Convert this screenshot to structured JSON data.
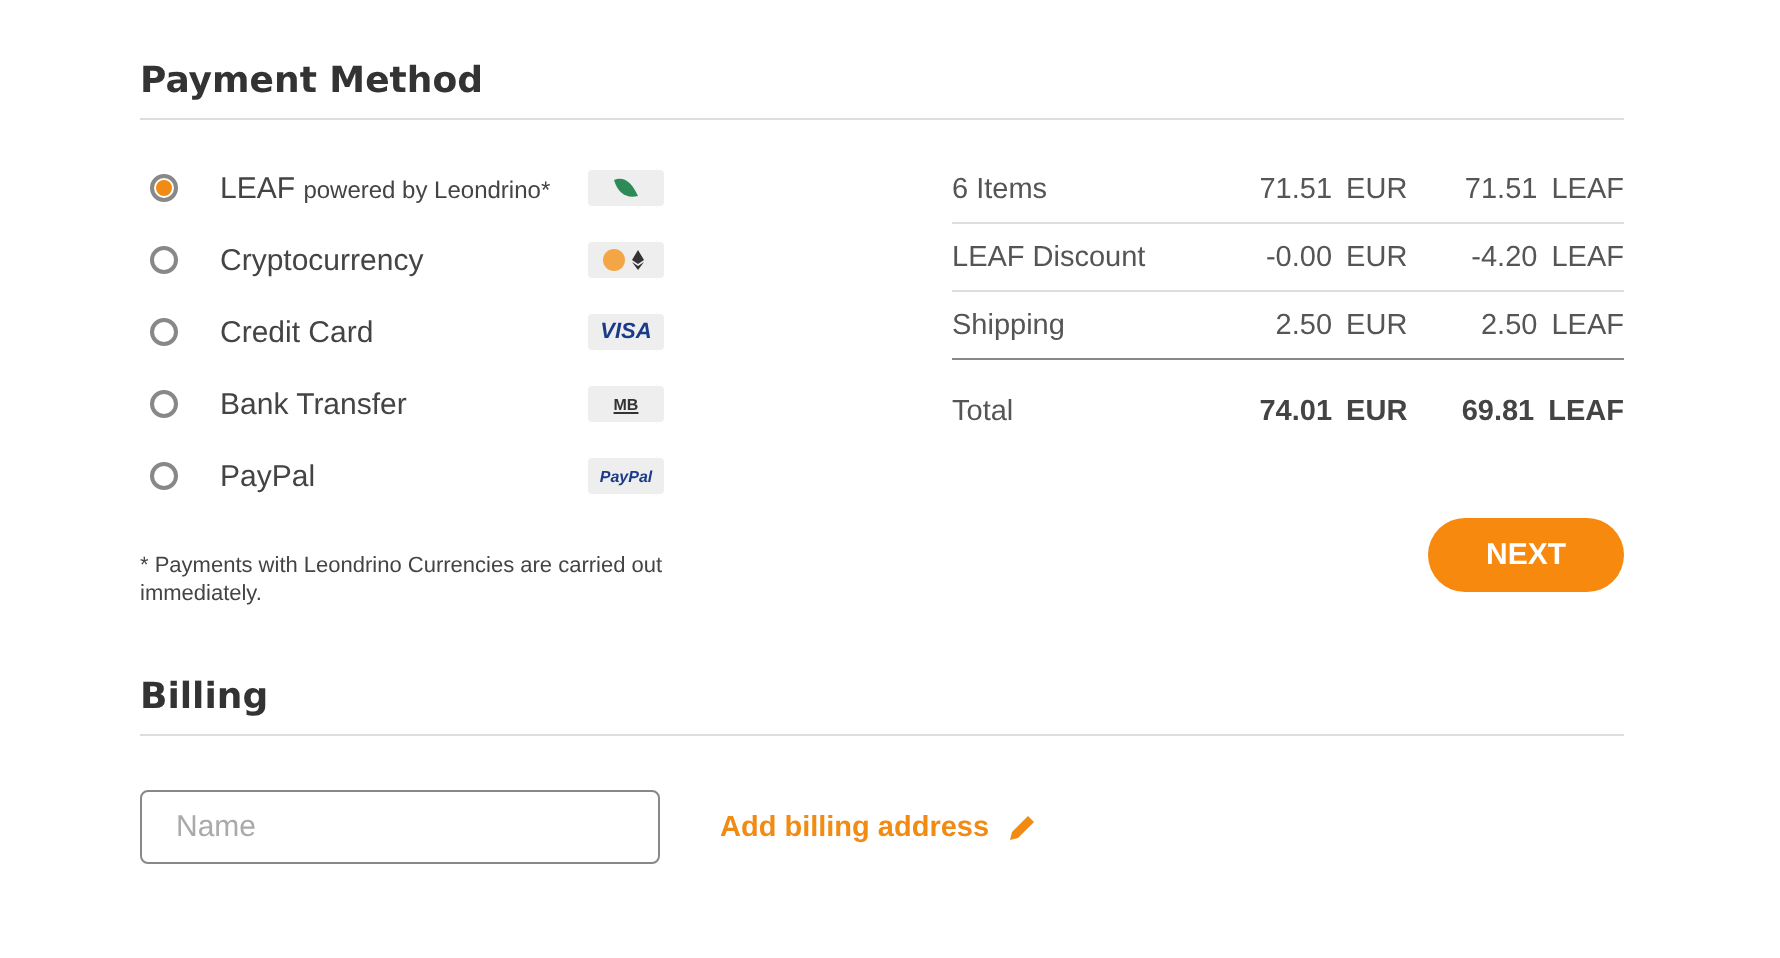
{
  "payment": {
    "title": "Payment Method",
    "methods": [
      {
        "label": "LEAF",
        "sublabel": "powered by Leondrino*",
        "selected": true,
        "kind": "leaf"
      },
      {
        "label": "Cryptocurrency",
        "selected": false,
        "kind": "crypto"
      },
      {
        "label": "Credit Card",
        "selected": false,
        "kind": "card",
        "logo_text": "VISA"
      },
      {
        "label": "Bank Transfer",
        "selected": false,
        "kind": "bank",
        "logo_text": "MB"
      },
      {
        "label": "PayPal",
        "selected": false,
        "kind": "paypal",
        "logo_text": "PayPal"
      }
    ],
    "note": "* Payments with Leondrino Currencies are carried out immediately.",
    "summary": [
      {
        "label": "6 Items",
        "eur": "71.51 EUR",
        "leaf": "71.51 LEAF",
        "kind": "line"
      },
      {
        "label": "LEAF Discount",
        "eur": "-0.00 EUR",
        "leaf": "-4.20 LEAF",
        "kind": "line"
      },
      {
        "label": "Shipping",
        "eur": "2.50 EUR",
        "leaf": "2.50 LEAF",
        "kind": "line"
      },
      {
        "label": "Total",
        "eur": "74.01 EUR",
        "leaf": "69.81 LEAF",
        "kind": "total"
      }
    ],
    "next_button": "NEXT"
  },
  "billing": {
    "title": "Billing",
    "name_field": {
      "placeholder": "Name"
    },
    "add_link": "Add billing address"
  }
}
